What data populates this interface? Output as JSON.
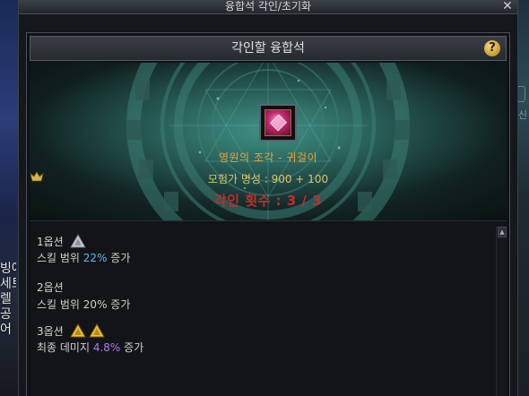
{
  "window": {
    "title": "융합석 각인/초기화",
    "close_label": "✕"
  },
  "header": {
    "title": "각인할 융합석",
    "help_label": "?"
  },
  "item": {
    "name": "영원의 조각 - 귀걸이",
    "fame_label": "모험가 명성 : 900 + 100",
    "engrave_label": "각인 횟수 : 3 / 3",
    "icon": "earring-gem-icon"
  },
  "options": [
    {
      "title": "1옵션",
      "grade_icons": [
        "silver-triangle-icon"
      ],
      "desc_prefix": "스킬 범위 ",
      "desc_value": "22%",
      "desc_suffix": " 증가",
      "value_color": "#56b9f0"
    },
    {
      "title": "2옵션",
      "grade_icons": [],
      "desc_prefix": "스킬 범위 ",
      "desc_value": "20%",
      "desc_suffix": " 증가",
      "value_color": "#cfcfcf"
    },
    {
      "title": "3옵션",
      "grade_icons": [
        "gold-triangle-icon",
        "gold-triangle-icon"
      ],
      "desc_prefix": "최종 데미지 ",
      "desc_value": "4.8%",
      "desc_suffix": " 증가",
      "value_color": "#b27aff"
    }
  ],
  "background": {
    "left_text": "빙에\n세트\n렐\n공\n어",
    "right_text": "신"
  },
  "colors": {
    "item_name": "#e8a33b",
    "fame": "#e3c566",
    "engrave_count": "#c42c2c",
    "accent_teal": "#2e6b62"
  }
}
